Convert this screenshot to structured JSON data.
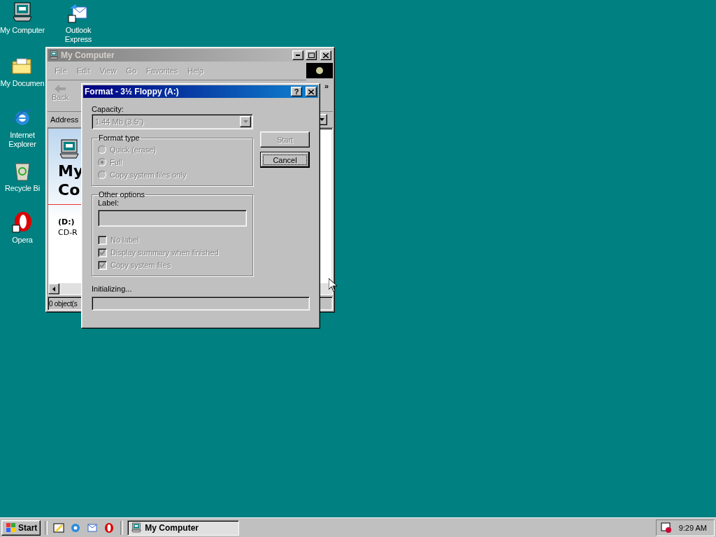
{
  "desktop_icons": [
    {
      "label": "My Computer",
      "kind": "computer"
    },
    {
      "label": "Outlook\nExpress",
      "kind": "mail"
    },
    {
      "label": "My Documen",
      "kind": "folder"
    },
    {
      "label": "Internet\nExplorer",
      "kind": "browser"
    },
    {
      "label": "Recycle Bi",
      "kind": "recycle"
    },
    {
      "label": "Opera",
      "kind": "opera"
    }
  ],
  "explorer": {
    "title": "My Computer",
    "menu": [
      "File",
      "Edit",
      "View",
      "Go",
      "Favorites",
      "Help"
    ],
    "back": "Back",
    "more": "»",
    "address_label": "Address",
    "heading_lines": [
      "My",
      "Co"
    ],
    "drive_name": "(D:)",
    "drive_type": "CD-R",
    "status": "0 object(s"
  },
  "dialog": {
    "title": "Format - 3½ Floppy (A:)",
    "help": "?",
    "capacity_label": "Capacity:",
    "capacity_value": "1.44 Mb (3.5\")",
    "capacity_disabled": true,
    "buttons": [
      {
        "label": "Start",
        "disabled": true,
        "focused": false
      },
      {
        "label": "Cancel",
        "disabled": false,
        "focused": true
      }
    ],
    "format_type": {
      "title": "Format type",
      "options": [
        {
          "label": "Quick (erase)",
          "selected": false,
          "disabled": true
        },
        {
          "label": "Full",
          "selected": true,
          "disabled": true
        },
        {
          "label": "Copy system files only",
          "selected": false,
          "disabled": true
        }
      ]
    },
    "other_options": {
      "title": "Other options",
      "label_caption": "Label:",
      "checkboxes": [
        {
          "label": "No label",
          "checked": false,
          "disabled": true
        },
        {
          "label": "Display summary when finished",
          "checked": true,
          "disabled": true
        },
        {
          "label": "Copy system files",
          "checked": true,
          "disabled": true
        }
      ]
    },
    "status": "Initializing...",
    "progress": {
      "level": 0
    }
  },
  "taskbar": {
    "start": "Start",
    "quick_launch": [
      {
        "kind": "desktop"
      },
      {
        "kind": "browser"
      },
      {
        "kind": "mail"
      },
      {
        "kind": "opera"
      }
    ],
    "tasks": [
      {
        "label": "My Computer",
        "selected": true
      }
    ],
    "clock": "9:29 AM"
  }
}
